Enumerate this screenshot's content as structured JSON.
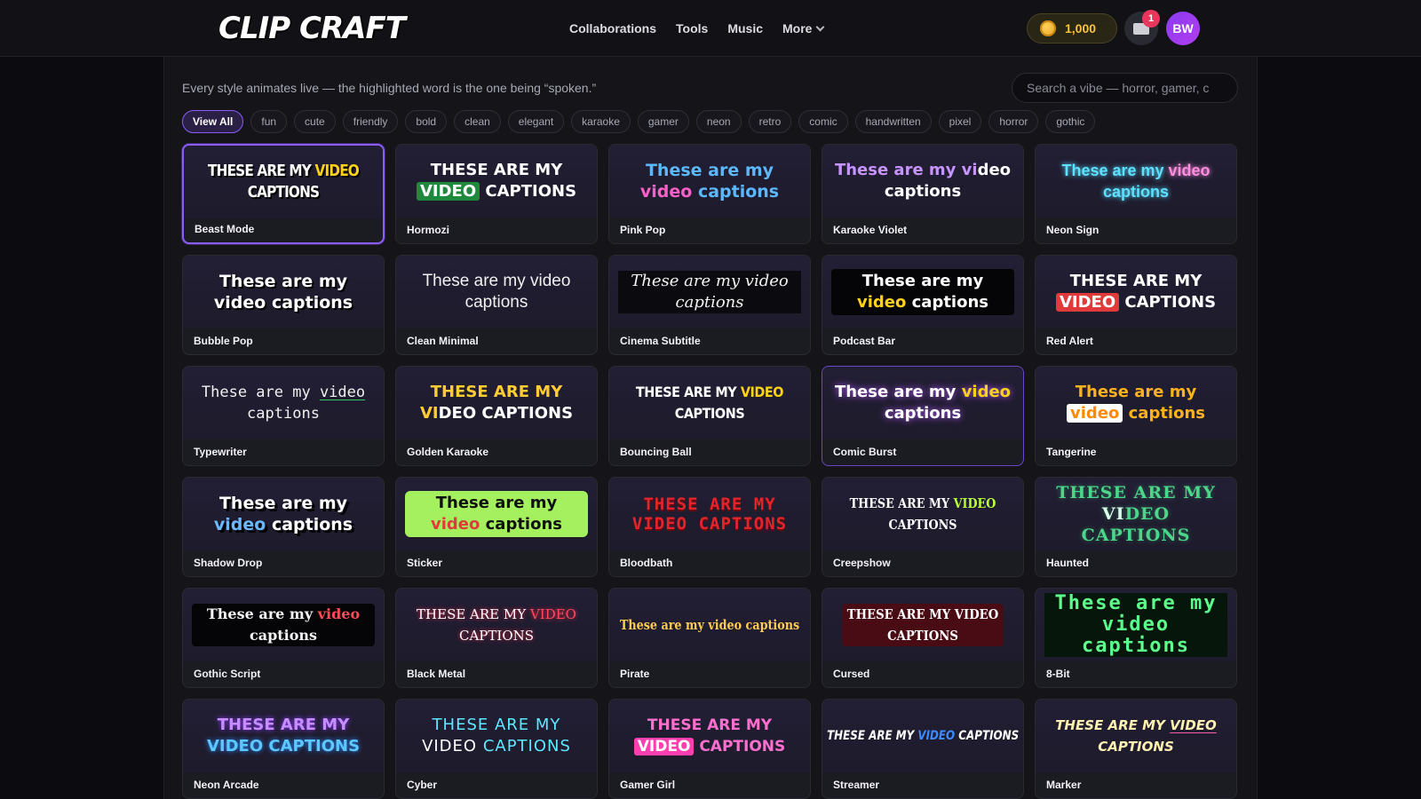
{
  "brand": {
    "name": "CLIP CRAFT"
  },
  "nav": {
    "items": [
      "Collaborations",
      "Tools",
      "Music"
    ],
    "more_label": "More"
  },
  "header": {
    "coins": "1,000",
    "notification_count": "1",
    "avatar_initials": "BW"
  },
  "main": {
    "intro": "Every style animates live — the highlighted word is the one being “spoken.”",
    "search_placeholder": "Search a vibe — horror, gamer, c",
    "filters": [
      "View All",
      "fun",
      "cute",
      "friendly",
      "bold",
      "clean",
      "elegant",
      "karaoke",
      "gamer",
      "neon",
      "retro",
      "comic",
      "handwritten",
      "pixel",
      "horror",
      "gothic"
    ],
    "active_filter": "View All"
  },
  "styles": [
    {
      "name": "Beast Mode",
      "caption": [
        "THESE ARE MY ",
        "VIDEO",
        " CAPTIONS"
      ]
    },
    {
      "name": "Hormozi",
      "caption": [
        "THESE ARE MY ",
        "VIDEO",
        " CAPTIONS"
      ]
    },
    {
      "name": "Pink Pop",
      "caption": [
        "These are my ",
        "video",
        " captions"
      ]
    },
    {
      "name": "Karaoke Violet",
      "caption": [
        "These are my vi",
        "deo",
        " captions"
      ]
    },
    {
      "name": "Neon Sign",
      "caption": [
        "These are my ",
        "video",
        " captions"
      ]
    },
    {
      "name": "Bubble Pop",
      "caption": [
        "These are my ",
        "video",
        " captions"
      ]
    },
    {
      "name": "Clean Minimal",
      "caption": [
        "These are my ",
        "video",
        " captions"
      ]
    },
    {
      "name": "Cinema Subtitle",
      "caption": [
        "These are my ",
        "video",
        " captions"
      ]
    },
    {
      "name": "Podcast Bar",
      "caption": [
        "These are my ",
        "video",
        " captions"
      ]
    },
    {
      "name": "Red Alert",
      "caption": [
        "THESE ARE MY ",
        "VIDEO",
        " CAPTIONS"
      ]
    },
    {
      "name": "Typewriter",
      "caption": [
        "These are my ",
        "video",
        " captions"
      ]
    },
    {
      "name": "Golden Karaoke",
      "caption": [
        "THESE ARE MY VI",
        "DEO",
        " CAPTIONS"
      ]
    },
    {
      "name": "Bouncing Ball",
      "caption": [
        "THESE ARE MY ",
        "VIDEO",
        " CAPTIONS"
      ]
    },
    {
      "name": "Comic Burst",
      "caption": [
        "These are my ",
        "video",
        " captions"
      ]
    },
    {
      "name": "Tangerine",
      "caption": [
        "These are my ",
        "video",
        " captions"
      ]
    },
    {
      "name": "Shadow Drop",
      "caption": [
        "These are my ",
        "video",
        " captions"
      ]
    },
    {
      "name": "Sticker",
      "caption": [
        "These are my ",
        "video",
        " captions"
      ]
    },
    {
      "name": "Bloodbath",
      "caption": [
        "THESE ARE MY ",
        "VIDEO",
        " CAPTIONS"
      ]
    },
    {
      "name": "Creepshow",
      "caption": [
        "THESE ARE MY ",
        "VIDEO",
        " CAPTIONS"
      ]
    },
    {
      "name": "Haunted",
      "caption": [
        "THESE ARE MY ",
        "VI",
        "DEO CAPTIONS"
      ]
    },
    {
      "name": "Gothic Script",
      "caption": [
        "These are my ",
        "video",
        " captions"
      ]
    },
    {
      "name": "Black Metal",
      "caption": [
        "THESE ARE MY ",
        "VIDEO",
        " CAPTIONS"
      ]
    },
    {
      "name": "Pirate",
      "caption": [
        "These are my ",
        "video",
        " captions"
      ]
    },
    {
      "name": "Cursed",
      "caption": [
        "THESE ARE MY ",
        "VIDEO",
        " CAPTIONS"
      ]
    },
    {
      "name": "8-Bit",
      "caption": [
        "These are my ",
        "video",
        " captions"
      ]
    },
    {
      "name": "Neon Arcade",
      "caption": [
        "THESE ARE MY ",
        "VIDEO",
        " CAPTIONS"
      ]
    },
    {
      "name": "Cyber",
      "caption": [
        "THESE ARE MY ",
        "VIDEO",
        " CAPTIONS"
      ]
    },
    {
      "name": "Gamer Girl",
      "caption": [
        "THESE ARE MY ",
        "VIDEO",
        " CAPTIONS"
      ]
    },
    {
      "name": "Streamer",
      "caption": [
        "THESE ARE MY ",
        "VIDEO",
        " CAPTIONS"
      ]
    },
    {
      "name": "Marker",
      "caption": [
        "THESE ARE MY ",
        "VIDEO",
        " CAPTIONS"
      ]
    }
  ],
  "selected_style": "Beast Mode",
  "colors": {
    "accent": "#8b5cf6",
    "coin": "#f6c340",
    "badge": "#e8365d"
  }
}
